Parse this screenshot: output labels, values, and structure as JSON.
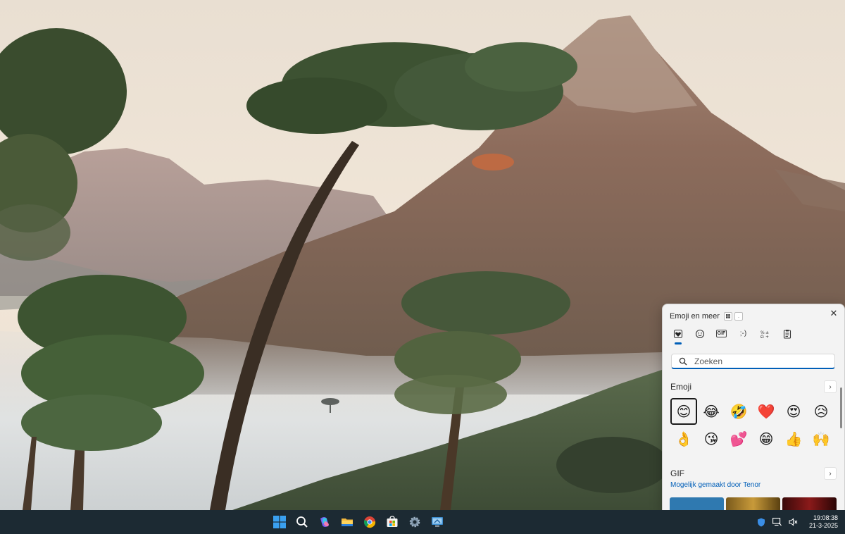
{
  "emoji_panel": {
    "title": "Emoji en meer",
    "tabs": [
      {
        "name": "recent",
        "icon": "heart-icon"
      },
      {
        "name": "emoji",
        "icon": "smiley-icon"
      },
      {
        "name": "gif",
        "label": "GIF"
      },
      {
        "name": "kaomoji",
        "label": ";-)"
      },
      {
        "name": "symbols",
        "icon": "symbols-icon"
      },
      {
        "name": "clipboard",
        "icon": "clipboard-icon"
      }
    ],
    "search": {
      "placeholder": "Zoeken"
    },
    "emoji_section": {
      "title": "Emoji",
      "items": [
        "😊",
        "😂",
        "🤣",
        "❤️",
        "😍",
        "😥",
        "👌",
        "😘",
        "💕",
        "😁",
        "👍",
        "🙌"
      ]
    },
    "gif_section": {
      "title": "GIF",
      "link": "Mogelijk gemaakt door Tenor"
    },
    "colors": {
      "accent": "#005fb8",
      "panel_bg": "#f3f3f3"
    }
  },
  "taskbar": {
    "apps": [
      "start-icon",
      "search-icon",
      "copilot-icon",
      "file-explorer-icon",
      "chrome-icon",
      "microsoft-store-icon",
      "settings-icon",
      "remote-desktop-icon"
    ],
    "clock": {
      "time": "19:08:38",
      "date": "21-3-2025"
    },
    "colors": {
      "background": "#1c2a33"
    }
  }
}
